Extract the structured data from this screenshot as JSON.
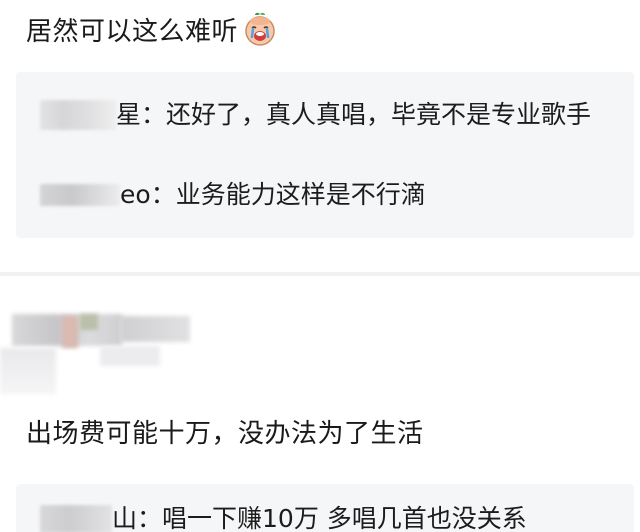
{
  "comment_1": {
    "text": "居然可以这么难听",
    "emoji": "crying-face-emoji",
    "replies": [
      {
        "name_visible_tail": "星",
        "text": "：还好了，真人真唱，毕竟不是专业歌手"
      },
      {
        "name_visible_tail": "eo",
        "text": "：业务能力这样是不行滴"
      }
    ]
  },
  "comment_2": {
    "text": "出场费可能十万，没办法为了生活",
    "replies": [
      {
        "name_visible_tail": "山",
        "text": "：唱一下赚10万 多唱几首也没关系"
      }
    ]
  },
  "colors": {
    "reply_background": "#f5f6f8",
    "divider": "#f0f1f3",
    "text": "#1a1a1a"
  }
}
